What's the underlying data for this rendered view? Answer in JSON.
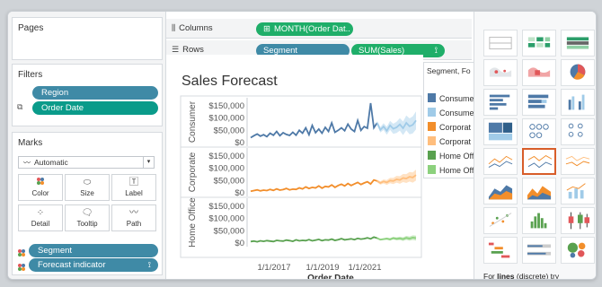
{
  "panels": {
    "pages": {
      "title": "Pages"
    },
    "filters": {
      "title": "Filters",
      "items": [
        "Region",
        "Order Date"
      ]
    },
    "marks": {
      "title": "Marks",
      "type_select": "Automatic",
      "buttons": [
        "Color",
        "Size",
        "Label",
        "Detail",
        "Tooltip",
        "Path"
      ],
      "fields": [
        "Segment",
        "Forecast indicator"
      ]
    }
  },
  "shelves": {
    "columns": {
      "label": "Columns",
      "pills": [
        "MONTH(Order Dat.."
      ]
    },
    "rows": {
      "label": "Rows",
      "pills": [
        "Segment",
        "SUM(Sales)"
      ]
    }
  },
  "legend": {
    "title": "Segment, Fo",
    "items": [
      "Consume",
      "Consume",
      "Corporat",
      "Corporat",
      "Home Offi",
      "Home Offi"
    ]
  },
  "showme": {
    "hint_prefix": "For ",
    "hint_bold": "lines",
    "hint_suffix": " (discrete) try"
  },
  "colors": {
    "consumer": "#4e79a7",
    "consumer_forecast": "#a0cbe8",
    "corporate": "#f28e2b",
    "corporate_forecast": "#ffbe7d",
    "home_office": "#59a14f",
    "home_office_forecast": "#8cd17d"
  },
  "chart_data": {
    "type": "line",
    "title": "Sales Forecast",
    "xlabel": "Order Date",
    "x_ticks": [
      "1/1/2017",
      "1/1/2019",
      "1/1/2021"
    ],
    "panes": [
      {
        "name": "Consumer",
        "ylim": [
          0,
          160000
        ],
        "y_ticks": [
          "$0",
          "$50,000",
          "$100,000",
          "$150,000"
        ],
        "actual": [
          20000,
          28000,
          35000,
          26000,
          32000,
          24000,
          38000,
          30000,
          45000,
          28000,
          40000,
          33000,
          29000,
          42000,
          30000,
          50000,
          38000,
          60000,
          32000,
          70000,
          40000,
          55000,
          38000,
          62000,
          45000,
          80000,
          42000,
          50000,
          60000,
          48000,
          75000,
          55000,
          45000,
          90000,
          50000,
          65000,
          58000,
          160000,
          60000,
          80000
        ],
        "forecast": [
          52000,
          65000,
          48000,
          70000,
          56000,
          62000,
          74000,
          58000,
          80000,
          66000,
          72000,
          90000
        ],
        "band": 30000
      },
      {
        "name": "Corporate",
        "ylim": [
          0,
          160000
        ],
        "y_ticks": [
          "$0",
          "$50,000",
          "$100,000",
          "$150,000"
        ],
        "actual": [
          6000,
          9000,
          12000,
          8000,
          11000,
          9000,
          14000,
          10000,
          16000,
          11000,
          13000,
          18000,
          12000,
          15000,
          14000,
          20000,
          16000,
          24000,
          18000,
          22000,
          20000,
          28000,
          19000,
          26000,
          24000,
          32000,
          22000,
          30000,
          35000,
          28000,
          38000,
          30000,
          36000,
          42000,
          34000,
          40000,
          45000,
          36000,
          52000,
          48000
        ],
        "forecast": [
          40000,
          46000,
          42000,
          50000,
          48000,
          55000,
          52000,
          60000,
          58000,
          65000,
          62000,
          72000
        ],
        "band": 18000
      },
      {
        "name": "Home Office",
        "ylim": [
          0,
          160000
        ],
        "y_ticks": [
          "$0",
          "$50,000",
          "$100,000",
          "$150,000"
        ],
        "actual": [
          6000,
          8000,
          5000,
          9000,
          7000,
          10000,
          8000,
          6000,
          11000,
          9000,
          8000,
          12000,
          10000,
          7000,
          13000,
          9000,
          11000,
          10000,
          14000,
          9000,
          12000,
          15000,
          10000,
          13000,
          12000,
          16000,
          11000,
          14000,
          18000,
          13000,
          15000,
          17000,
          14000,
          19000,
          16000,
          18000,
          21000,
          17000,
          24000,
          20000
        ],
        "forecast": [
          14000,
          16000,
          18000,
          15000,
          20000,
          17000,
          19000,
          16000,
          21000,
          18000,
          22000,
          20000
        ],
        "band": 8000
      }
    ]
  }
}
